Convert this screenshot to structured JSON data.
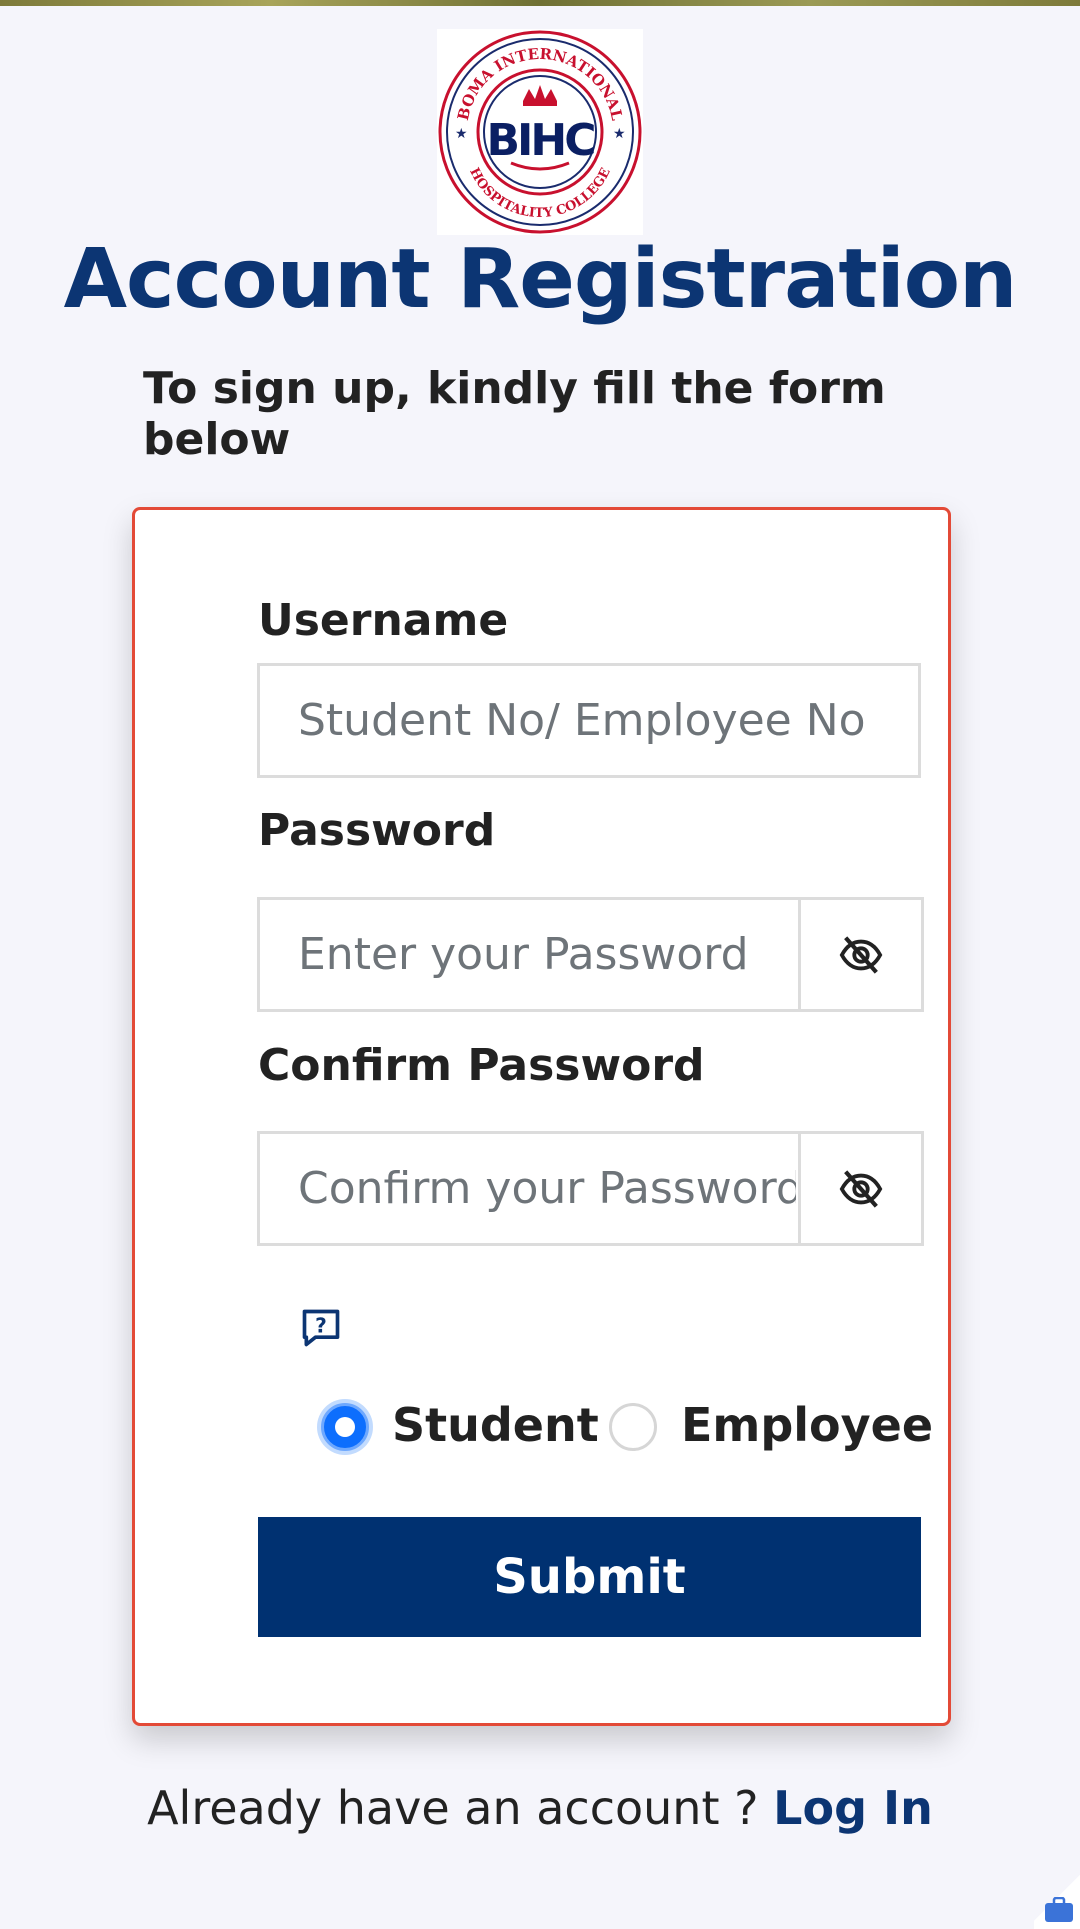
{
  "logo": {
    "name": "bihc-logo",
    "text_top": "BOMA INTERNATIONAL",
    "text_bottom": "HOSPITALITY COLLEGE",
    "monogram": "BIHC"
  },
  "header": {
    "title": "Account Registration",
    "subtitle": "To sign up, kindly fill the form below"
  },
  "form": {
    "username": {
      "label": "Username",
      "placeholder": "Student No/ Employee No",
      "value": ""
    },
    "password": {
      "label": "Password",
      "placeholder": "Enter your Password",
      "value": "",
      "toggle_icon": "eye-slash-icon"
    },
    "confirm_password": {
      "label": "Confirm Password",
      "placeholder": "Confirm your Password",
      "value": "",
      "toggle_icon": "eye-slash-icon"
    },
    "help_icon": "question-chat-icon",
    "role_options": [
      {
        "label": "Student",
        "selected": true
      },
      {
        "label": "Employee",
        "selected": false
      }
    ],
    "submit_label": "Submit"
  },
  "footer": {
    "prompt": "Already have an account ? ",
    "login_label": "Log In"
  },
  "colors": {
    "primary": "#0c3573",
    "button": "#003171",
    "card_border": "#e34a37",
    "radio_selected": "#0d6efd",
    "background": "#f5f5fb"
  }
}
